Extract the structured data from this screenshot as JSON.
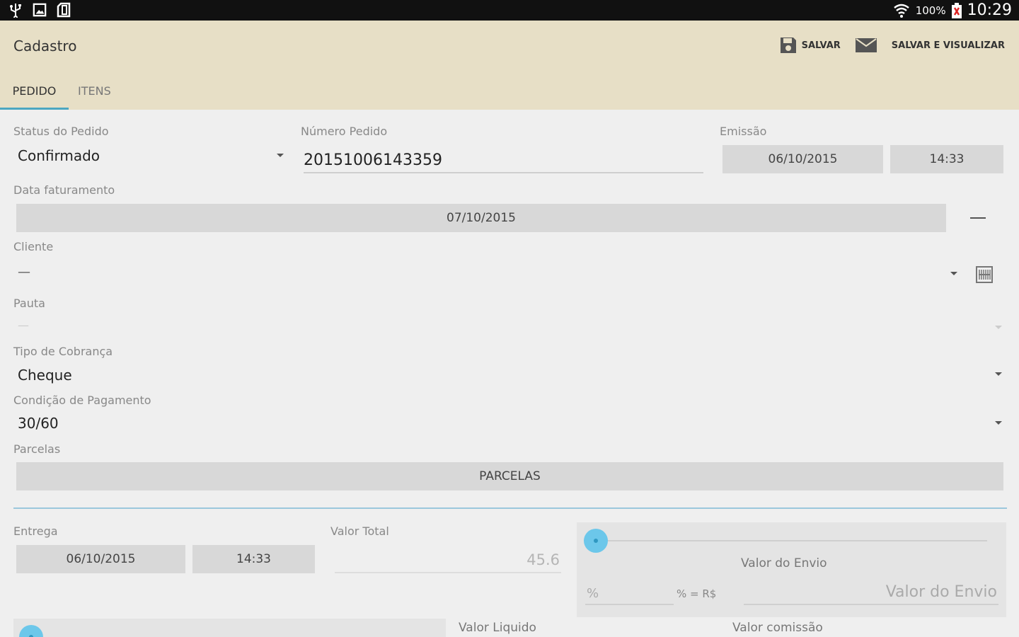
{
  "statusbar": {
    "battery_percent": "100%",
    "time": "10:29",
    "icons": [
      "usb-icon",
      "image-icon",
      "sd-card-icon",
      "wifi-icon",
      "battery-low-icon"
    ]
  },
  "actionbar": {
    "title": "Cadastro",
    "save_label": "SALVAR",
    "save_and_view_label": "SALVAR E VISUALIZAR",
    "tabs": [
      {
        "label": "PEDIDO",
        "active": true
      },
      {
        "label": "ITENS",
        "active": false
      }
    ]
  },
  "form": {
    "status": {
      "label": "Status do Pedido",
      "value": "Confirmado"
    },
    "numero": {
      "label": "Número Pedido",
      "value": "20151006143359"
    },
    "emissao": {
      "label": "Emissão",
      "date": "06/10/2015",
      "time": "14:33"
    },
    "faturamento": {
      "label": "Data faturamento",
      "date": "07/10/2015"
    },
    "cliente": {
      "label": "Cliente",
      "value": "—"
    },
    "pauta": {
      "label": "Pauta",
      "value": "—"
    },
    "cobranca": {
      "label": "Tipo de Cobrança",
      "value": "Cheque"
    },
    "condicao": {
      "label": "Condição de Pagamento",
      "value": "30/60"
    },
    "parcelas": {
      "label": "Parcelas",
      "button": "PARCELAS"
    },
    "entrega": {
      "label": "Entrega",
      "date": "06/10/2015",
      "time": "14:33"
    },
    "valor_total": {
      "label": "Valor Total",
      "value": "45.6"
    },
    "envio": {
      "title": "Valor do Envio",
      "percent_placeholder": "%",
      "conversion_label": "% = R$",
      "value_placeholder": "Valor do Envio"
    },
    "valor_liquido": {
      "label": "Valor Liquido"
    },
    "valor_comissao": {
      "label": "Valor comissão"
    }
  },
  "colors": {
    "actionbar_bg": "#e7dfc6",
    "accent": "#4ca7c1",
    "slider_thumb": "#6cc7ea"
  }
}
